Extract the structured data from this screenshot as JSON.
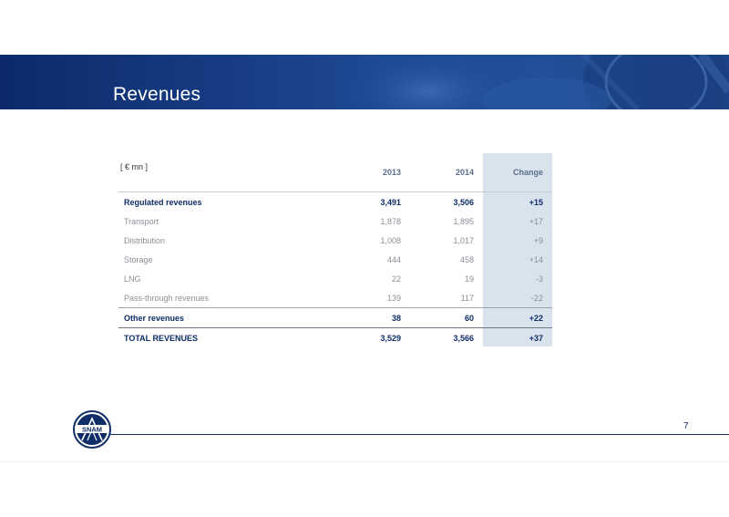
{
  "slide": {
    "title": "Revenues",
    "page_number": "7"
  },
  "table": {
    "unit": "[ € mn ]",
    "columns": [
      "",
      "2013",
      "2014",
      "Change"
    ],
    "rows": [
      {
        "label": "Regulated revenues",
        "y2013": "3,491",
        "y2014": "3,506",
        "change": "+15"
      },
      {
        "label": "Transport",
        "y2013": "1,878",
        "y2014": "1,895",
        "change": "+17"
      },
      {
        "label": "Distribution",
        "y2013": "1,008",
        "y2014": "1,017",
        "change": "+9"
      },
      {
        "label": "Storage",
        "y2013": "444",
        "y2014": "458",
        "change": "+14"
      },
      {
        "label": "LNG",
        "y2013": "22",
        "y2014": "19",
        "change": "-3"
      },
      {
        "label": "Pass-through revenues",
        "y2013": "139",
        "y2014": "117",
        "change": "-22"
      },
      {
        "label": "Other revenues",
        "y2013": "38",
        "y2014": "60",
        "change": "+22"
      },
      {
        "label": "TOTAL REVENUES",
        "y2013": "3,529",
        "y2014": "3,566",
        "change": "+37"
      }
    ]
  },
  "logo": {
    "text": "SNAM"
  },
  "colors": {
    "brand_blue": "#0f2d66",
    "change_column_bg": "#d9e3ee"
  }
}
